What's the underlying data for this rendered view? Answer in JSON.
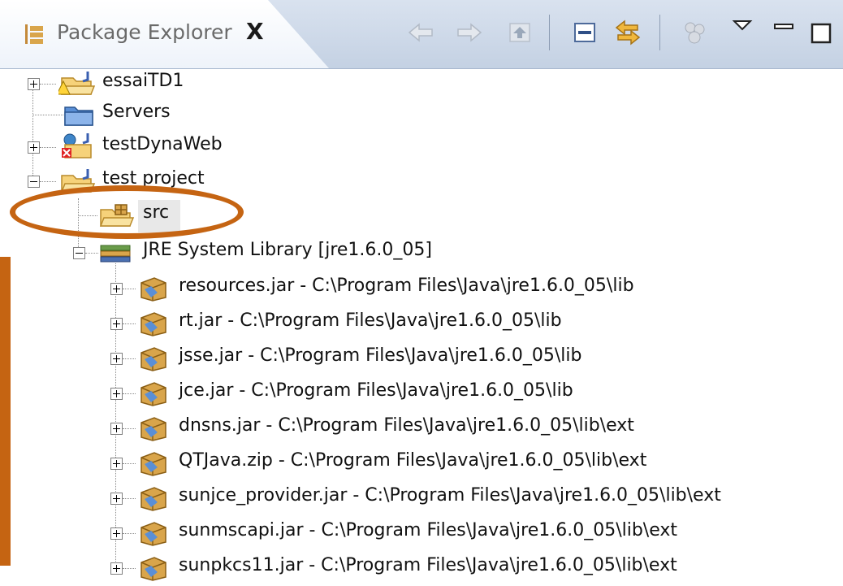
{
  "view": {
    "title": "Package Explorer",
    "close_label": "X"
  },
  "toolbar": {
    "buttons": [
      "back-icon",
      "forward-icon",
      "up-icon",
      "collapse-all-icon",
      "link-with-editor-icon",
      "filters-icon",
      "view-menu-icon",
      "minimize-icon",
      "maximize-icon"
    ]
  },
  "tree": {
    "projects": [
      {
        "label": "essaiTD1",
        "icon": "java-project-warning-icon",
        "expanded": false
      },
      {
        "label": "Servers",
        "icon": "folder-icon",
        "expanded": null
      },
      {
        "label": "testDynaWeb",
        "icon": "web-project-error-icon",
        "expanded": false
      },
      {
        "label": "test project",
        "icon": "java-project-icon",
        "expanded": true
      }
    ],
    "src_label": "src",
    "library_label": "JRE System Library [jre1.6.0_05]",
    "jars": [
      "resources.jar - C:\\Program Files\\Java\\jre1.6.0_05\\lib",
      "rt.jar - C:\\Program Files\\Java\\jre1.6.0_05\\lib",
      "jsse.jar - C:\\Program Files\\Java\\jre1.6.0_05\\lib",
      "jce.jar - C:\\Program Files\\Java\\jre1.6.0_05\\lib",
      "dnsns.jar - C:\\Program Files\\Java\\jre1.6.0_05\\lib\\ext",
      "QTJava.zip - C:\\Program Files\\Java\\jre1.6.0_05\\lib\\ext",
      "sunjce_provider.jar - C:\\Program Files\\Java\\jre1.6.0_05\\lib\\ext",
      "sunmscapi.jar - C:\\Program Files\\Java\\jre1.6.0_05\\lib\\ext",
      "sunpkcs11.jar - C:\\Program Files\\Java\\jre1.6.0_05\\lib\\ext"
    ]
  },
  "colors": {
    "annotation": "#c56412",
    "header": "#d3ddeb"
  }
}
